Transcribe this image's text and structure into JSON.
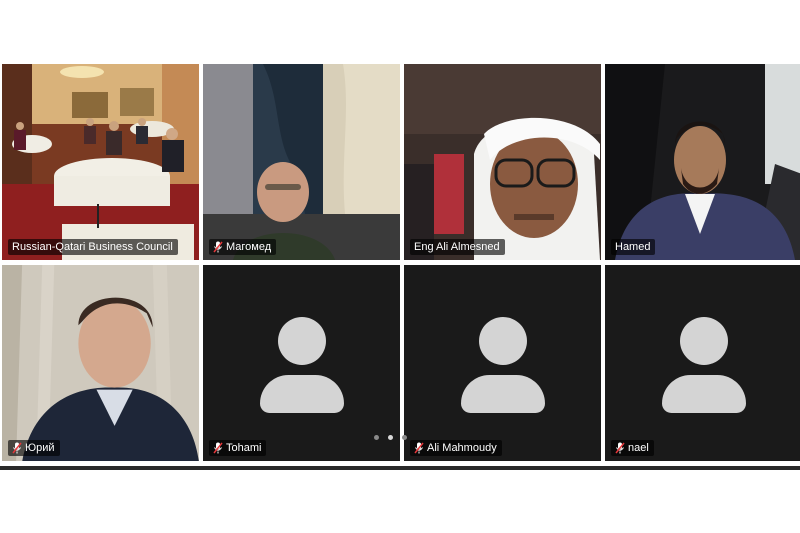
{
  "participants": [
    {
      "name": "Russian-Qatari Business Council",
      "muted": false,
      "video": true,
      "active": true
    },
    {
      "name": "Магомед",
      "muted": true,
      "video": true
    },
    {
      "name": "Eng Ali Almesned",
      "muted": false,
      "video": true
    },
    {
      "name": "Hamed",
      "muted": false,
      "video": true
    },
    {
      "name": "Юрий",
      "muted": true,
      "video": true
    },
    {
      "name": "Tohami",
      "muted": true,
      "video": false
    },
    {
      "name": "Ali Mahmoudy",
      "muted": true,
      "video": false
    },
    {
      "name": "nael",
      "muted": true,
      "video": false
    }
  ],
  "pagination": {
    "pages": 3,
    "current": 2
  },
  "colors": {
    "active_speaker_border": "#2ecc40",
    "tile_bg": "#1a1a1a",
    "avatar": "#d4d4d4"
  }
}
